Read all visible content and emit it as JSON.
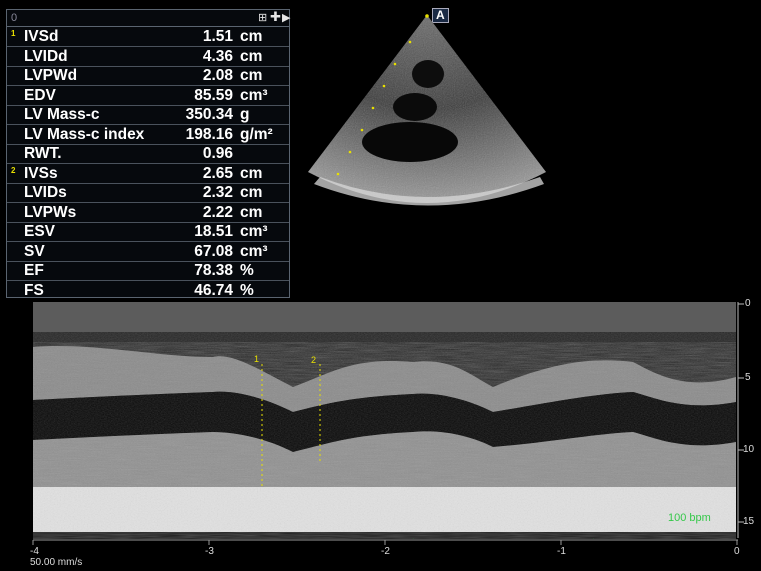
{
  "panel": {
    "toolbar_index": "0",
    "toolbar_icons": [
      "window-icon",
      "move-icon",
      "expand-arrow-icon"
    ],
    "rows": [
      {
        "marker": "1",
        "label": "IVSd",
        "value": "1.51",
        "unit": "cm"
      },
      {
        "marker": "",
        "label": "LVIDd",
        "value": "4.36",
        "unit": "cm"
      },
      {
        "marker": "",
        "label": "LVPWd",
        "value": "2.08",
        "unit": "cm"
      },
      {
        "marker": "",
        "label": "EDV",
        "value": "85.59",
        "unit": "cm³"
      },
      {
        "marker": "",
        "label": "LV Mass-c",
        "value": "350.34",
        "unit": "g"
      },
      {
        "marker": "",
        "label": "LV Mass-c index",
        "value": "198.16",
        "unit": "g/m²"
      },
      {
        "marker": "",
        "label": "RWT.",
        "value": "0.96",
        "unit": ""
      },
      {
        "marker": "2",
        "label": "IVSs",
        "value": "2.65",
        "unit": "cm"
      },
      {
        "marker": "",
        "label": "LVIDs",
        "value": "2.32",
        "unit": "cm"
      },
      {
        "marker": "",
        "label": "LVPWs",
        "value": "2.22",
        "unit": "cm"
      },
      {
        "marker": "",
        "label": "ESV",
        "value": "18.51",
        "unit": "cm³"
      },
      {
        "marker": "",
        "label": "SV",
        "value": "67.08",
        "unit": "cm³"
      },
      {
        "marker": "",
        "label": "EF",
        "value": "78.38",
        "unit": "%"
      },
      {
        "marker": "",
        "label": "FS",
        "value": "46.74",
        "unit": "%"
      }
    ]
  },
  "probe_icon_symbol": "A",
  "mmode": {
    "depth_labels": [
      "0",
      "5",
      "10",
      "15"
    ],
    "time_labels": [
      "-4",
      "-3",
      "-2",
      "-1",
      "0"
    ],
    "sweep_speed": "50.00 mm/s",
    "heart_rate": "100 bpm",
    "calipers": [
      "1",
      "2"
    ]
  },
  "colors": {
    "ecg": "#2fb83e",
    "marker": "#e8e000",
    "panel_border": "#5a6470"
  }
}
